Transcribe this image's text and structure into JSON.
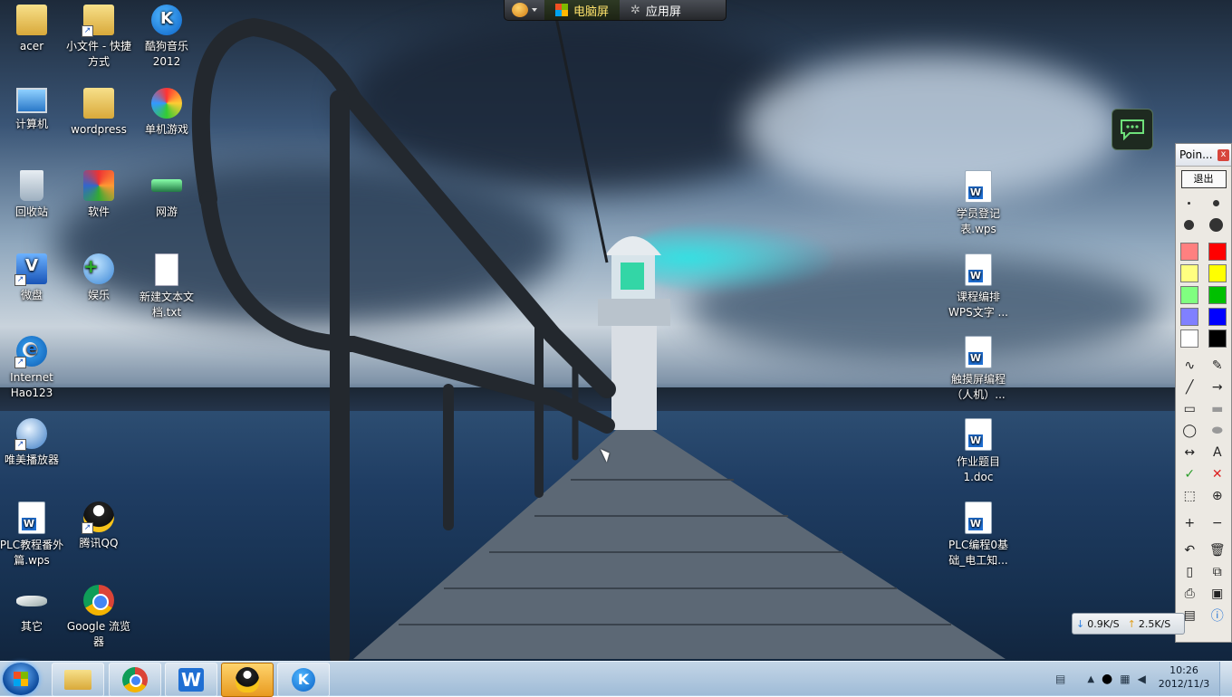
{
  "desktop_icons_left": [
    {
      "label": "acer",
      "icon": "user-folder-icon"
    },
    {
      "label": "小文件 - 快捷方式",
      "icon": "folder-shortcut-icon"
    },
    {
      "label": "酷狗音乐2012",
      "icon": "kugou-music-icon"
    },
    {
      "label": "计算机",
      "icon": "computer-icon"
    },
    {
      "label": "wordpress",
      "icon": "folder-icon"
    },
    {
      "label": "单机游戏",
      "icon": "games-icon"
    },
    {
      "label": "回收站",
      "icon": "recycle-bin-icon"
    },
    {
      "label": "软件",
      "icon": "software-icon"
    },
    {
      "label": "网游",
      "icon": "online-games-icon"
    },
    {
      "label": "微盘",
      "icon": "vdisk-icon"
    },
    {
      "label": "娱乐",
      "icon": "entertainment-icon"
    },
    {
      "label": "新建文本文档.txt",
      "icon": "text-file-icon"
    },
    {
      "label": "Internet Hao123",
      "icon": "ie-icon"
    },
    {
      "label": "唯美播放器",
      "icon": "media-player-icon"
    },
    {
      "label": "PLC教程番外篇.wps",
      "icon": "wps-document-icon"
    },
    {
      "label": "腾讯QQ",
      "icon": "qq-icon"
    },
    {
      "label": "其它",
      "icon": "other-icon"
    },
    {
      "label": "Google 流览器",
      "icon": "chrome-icon"
    }
  ],
  "desktop_icons_right": [
    {
      "label": "学员登记表.wps",
      "icon": "wps-document-icon"
    },
    {
      "label": "课程编排WPS文字 ...",
      "icon": "wps-document-icon"
    },
    {
      "label": "触摸屏编程（人机）...",
      "icon": "wps-document-icon"
    },
    {
      "label": "作业题目1.doc",
      "icon": "word-document-icon"
    },
    {
      "label": "PLC编程0基础_电工知...",
      "icon": "wps-document-icon"
    }
  ],
  "topbar": {
    "tab_pc": "电脑屏",
    "tab_apps": "应用屏"
  },
  "pointofix": {
    "title": "Poin...",
    "exit_label": "退出",
    "colors": [
      "#ff8080",
      "#ff0000",
      "#ffff80",
      "#ffff00",
      "#80ff80",
      "#00c000",
      "#8080ff",
      "#0000ff",
      "#ffffff",
      "#000000"
    ],
    "tools": [
      "freehand-icon",
      "eraser-icon",
      "line-icon",
      "arrow-icon",
      "rectangle-icon",
      "filled-rectangle-icon",
      "ellipse-icon",
      "filled-ellipse-icon",
      "double-arrow-icon",
      "text-icon",
      "checkmark-icon",
      "cross-icon",
      "select-icon",
      "zoom-icon",
      "plus-icon",
      "minus-icon",
      "undo-icon",
      "delete-icon",
      "new-page-icon",
      "copy-icon",
      "print-icon",
      "save-icon",
      "screen-icon",
      "info-icon"
    ]
  },
  "netspeed": {
    "down": "0.9K/S",
    "up": "2.5K/S"
  },
  "taskbar": {
    "items": [
      "explorer-icon",
      "chrome-icon",
      "wps-writer-icon",
      "qq-icon",
      "kugou-icon"
    ],
    "clock_time": "10:26",
    "clock_date": "2012/11/3"
  }
}
